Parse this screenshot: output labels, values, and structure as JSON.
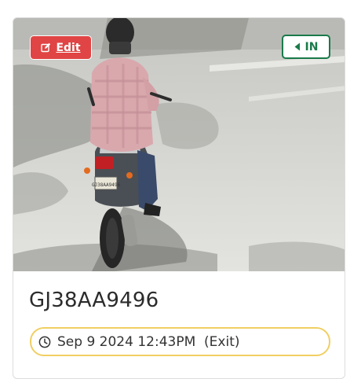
{
  "card": {
    "edit_label": "Edit",
    "edit_icon": "edit-icon",
    "direction_label": "IN",
    "direction_icon": "caret-left-icon",
    "plate_number": "GJ38AA9496",
    "timestamp": "Sep 9 2024 12:43PM  (Exit)",
    "timestamp_icon": "clock-icon",
    "photo_plate_text": "GJ38AA9496"
  },
  "colors": {
    "edit_bg": "#e04444",
    "direction_accent": "#1a7a4a",
    "timestamp_border": "#f0cf62"
  }
}
